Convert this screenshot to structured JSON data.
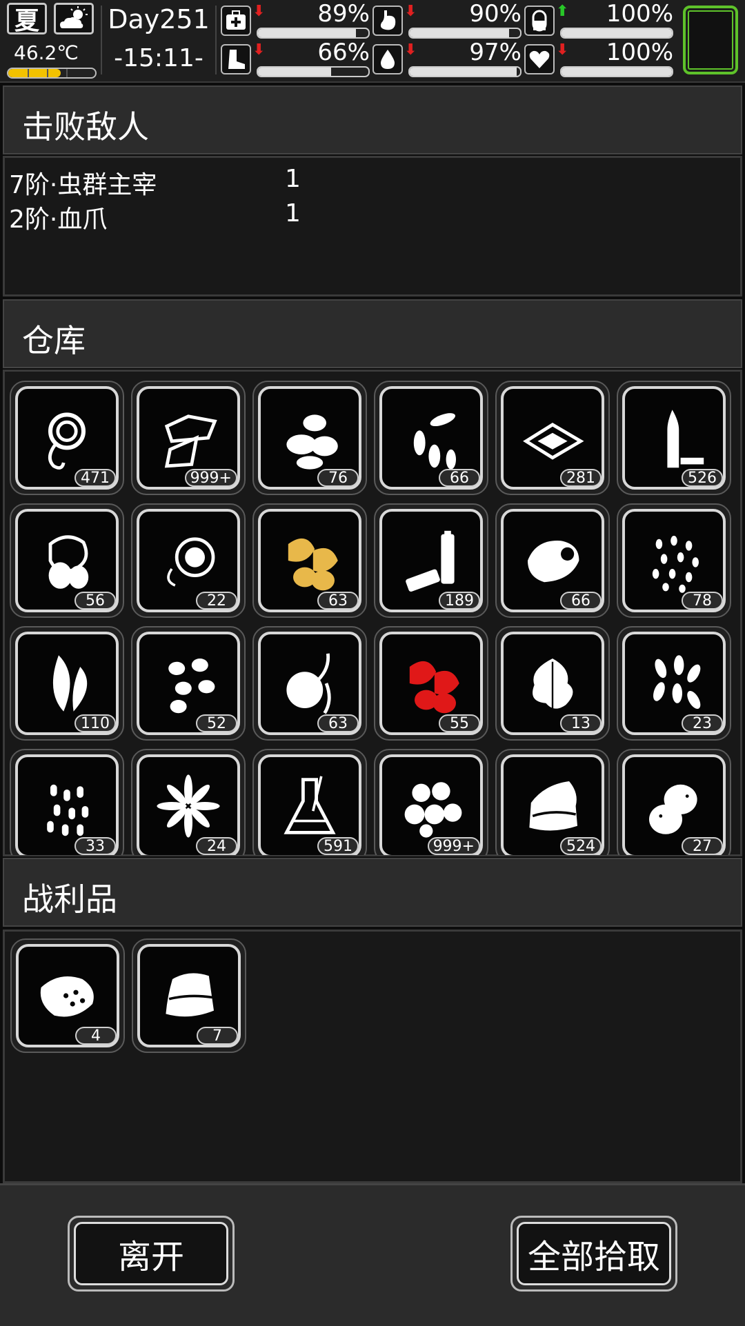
{
  "status": {
    "season": "夏",
    "weather_icon": "sun-cloud-icon",
    "temperature": "46.2℃",
    "temperature_level": 0.6,
    "day": "Day251",
    "time": "-15:11-",
    "stats": [
      {
        "name": "health",
        "icon": "medkit-icon",
        "pct": "89%",
        "level": 0.89,
        "trend": "down",
        "trend_color": "#e02020"
      },
      {
        "name": "stomach",
        "icon": "stomach-icon",
        "pct": "90%",
        "level": 0.9,
        "trend": "down",
        "trend_color": "#e02020"
      },
      {
        "name": "pill",
        "icon": "pill-icon",
        "pct": "100%",
        "level": 1.0,
        "trend": "up",
        "trend_color": "#28c828"
      },
      {
        "name": "stamina",
        "icon": "boot-icon",
        "pct": "66%",
        "level": 0.66,
        "trend": "down",
        "trend_color": "#e02020"
      },
      {
        "name": "water",
        "icon": "water-drop-icon",
        "pct": "97%",
        "level": 0.97,
        "trend": "down",
        "trend_color": "#e02020"
      },
      {
        "name": "mood",
        "icon": "heart-icon",
        "pct": "100%",
        "level": 1.0,
        "trend": "down",
        "trend_color": "#e02020"
      }
    ],
    "equipped_slot_color": "#5ec22a"
  },
  "enemies": {
    "title": "击败敌人",
    "list": [
      {
        "name": "7阶·虫群主宰",
        "count": "1"
      },
      {
        "name": "2阶·血爪",
        "count": "1"
      }
    ]
  },
  "warehouse": {
    "title": "仓库",
    "items": [
      {
        "icon": "rope-icon",
        "count": "471"
      },
      {
        "icon": "paper-sheets-icon",
        "count": "999+"
      },
      {
        "icon": "seeds-icon",
        "count": "76"
      },
      {
        "icon": "sunflower-seeds-icon",
        "count": "66"
      },
      {
        "icon": "dried-meat-icon",
        "count": "281"
      },
      {
        "icon": "bullet-icon",
        "count": "526"
      },
      {
        "icon": "herb-nuts-icon",
        "count": "56"
      },
      {
        "icon": "fruit-slice-icon",
        "count": "22"
      },
      {
        "icon": "yellow-herb-icon",
        "count": "63",
        "color": "#e8b84a"
      },
      {
        "icon": "battery-icon",
        "count": "189"
      },
      {
        "icon": "meat-chunk-icon",
        "count": "66"
      },
      {
        "icon": "grain-seeds-icon",
        "count": "78"
      },
      {
        "icon": "leaf-pair-icon",
        "count": "110"
      },
      {
        "icon": "cocoons-icon",
        "count": "52"
      },
      {
        "icon": "tuber-icon",
        "count": "63"
      },
      {
        "icon": "red-herb-icon",
        "count": "55",
        "color": "#e01818"
      },
      {
        "icon": "mint-leaf-icon",
        "count": "13"
      },
      {
        "icon": "petal-seeds-icon",
        "count": "23"
      },
      {
        "icon": "rice-grain-icon",
        "count": "33"
      },
      {
        "icon": "star-flower-icon",
        "count": "24"
      },
      {
        "icon": "flask-icon",
        "count": "591"
      },
      {
        "icon": "mushroom-pile-icon",
        "count": "999+"
      },
      {
        "icon": "cloth-icon",
        "count": "524"
      },
      {
        "icon": "potato-icon",
        "count": "27"
      }
    ]
  },
  "loot": {
    "title": "战利品",
    "items": [
      {
        "icon": "raw-meat-icon",
        "count": "4"
      },
      {
        "icon": "hide-icon",
        "count": "7"
      }
    ]
  },
  "buttons": {
    "leave": "离开",
    "pick_all": "全部拾取"
  }
}
